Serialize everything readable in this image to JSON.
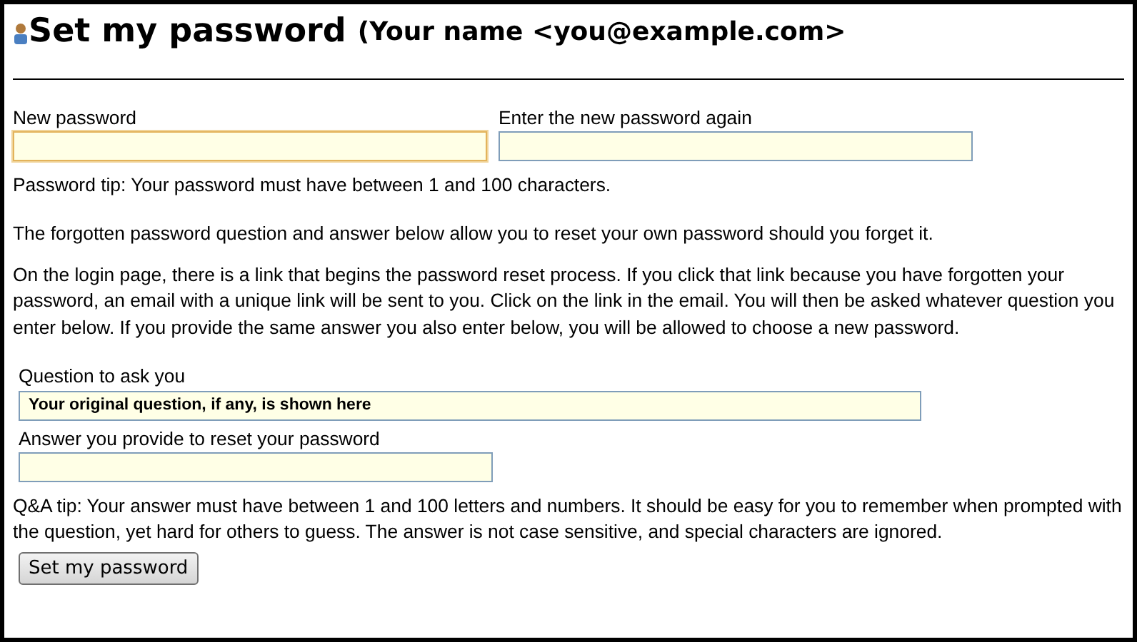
{
  "header": {
    "title": "Set my password",
    "subtitle": "(Your name <you@example.com>"
  },
  "password_fields": [
    {
      "label": "New password",
      "focused": true
    },
    {
      "label": "Enter the new password again",
      "focused": false
    }
  ],
  "password_tip": "Password tip: Your password must have between 1 and 100 characters.",
  "paragraphs": [
    "The forgotten password question and answer below allow you to reset your own password should you forget it.",
    "On the login page, there is a link that begins the password reset process. If you click that link because you have forgotten your password, an email with a unique link will be sent to you. Click on the link in the email. You will then be asked whatever question you enter below. If you provide the same answer you also enter below, you will be allowed to choose a new password."
  ],
  "question": {
    "label": "Question to ask you",
    "value": "Your original question, if any, is shown here"
  },
  "answer": {
    "label": "Answer you provide to reset your password"
  },
  "qa_tip": "Q&A tip: Your answer must have between 1 and 100 letters and numbers.  It should be easy for you to remember when prompted with the question, yet hard for others to guess. The answer is not case sensitive, and special characters are ignored.",
  "submit_button": "Set my password"
}
